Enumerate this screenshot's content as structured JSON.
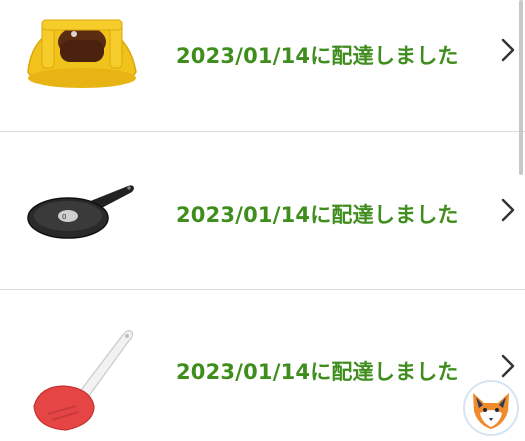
{
  "orders": [
    {
      "product": "yellow-dome-lid",
      "status": "2023/01/14に配達しました"
    },
    {
      "product": "frying-pan",
      "status": "2023/01/14に配達しました"
    },
    {
      "product": "red-spatula",
      "status": "2023/01/14に配達しました"
    }
  ],
  "colors": {
    "status_text": "#3f8d1d",
    "divider": "#dcdcdc",
    "chevron": "#333333"
  },
  "icons": {
    "row_arrow": "chevron-right-icon",
    "badge": "fox-logo-icon"
  }
}
